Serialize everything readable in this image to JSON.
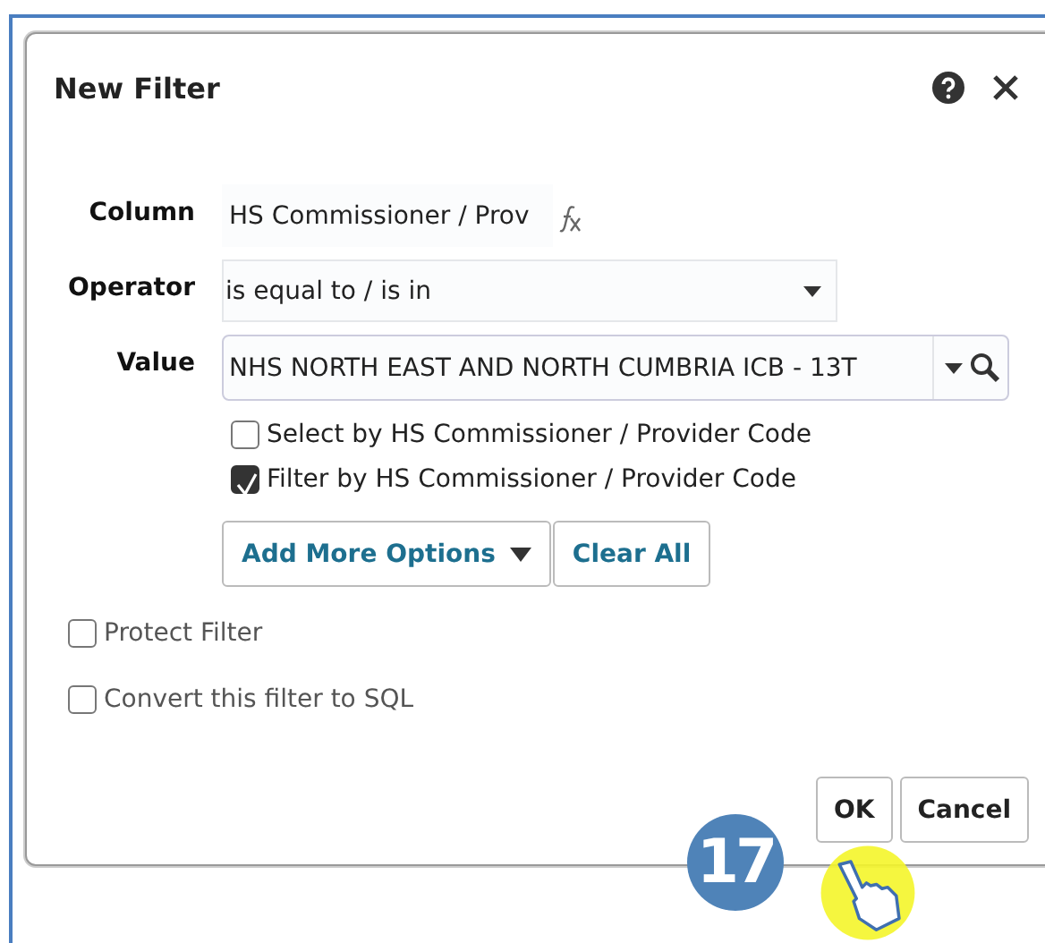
{
  "dialog": {
    "title": "New Filter"
  },
  "fields": [
    {
      "kind": "text",
      "label": "Column",
      "value": "HS Commissioner / Prov"
    },
    {
      "kind": "select",
      "label": "Operator",
      "value": "is equal to / is in"
    },
    {
      "kind": "search",
      "label": "Value",
      "value": "NHS NORTH EAST AND NORTH CUMBRIA ICB - 13T"
    }
  ],
  "value_options": [
    {
      "label": "Select by HS Commissioner / Provider Code",
      "checked": false
    },
    {
      "label": "Filter by HS Commissioner / Provider Code",
      "checked": true
    }
  ],
  "option_buttons": [
    {
      "label": "Add More Options",
      "kind": "menu"
    },
    {
      "label": "Clear All",
      "kind": "plain"
    }
  ],
  "filter_options": [
    {
      "label": "Protect Filter",
      "checked": false
    },
    {
      "label": "Convert this filter to SQL",
      "checked": false
    }
  ],
  "buttons": [
    "OK",
    "Cancel"
  ],
  "callout": {
    "number": "17"
  }
}
